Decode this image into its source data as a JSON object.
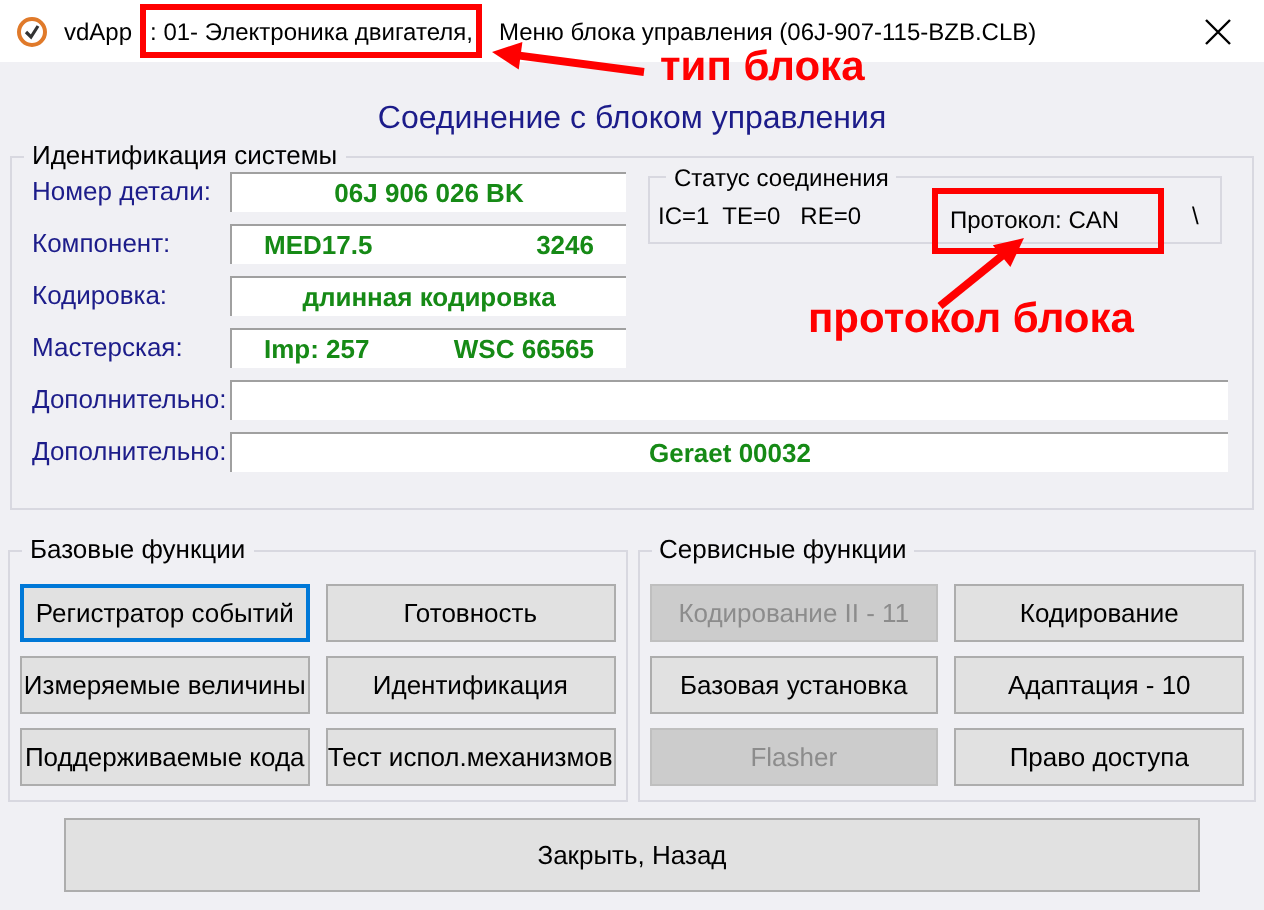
{
  "window": {
    "app_name": "vdApp",
    "module": ": 01- Электроника двигателя,",
    "title": "Меню блока управления (06J-907-115-BZB.CLB)"
  },
  "heading": "Соединение с блоком управления",
  "identification": {
    "title": "Идентификация системы",
    "rows": [
      {
        "label": "Номер детали:",
        "values": [
          "06J 906 026 BK"
        ],
        "wide": false
      },
      {
        "label": "Компонент:",
        "values": [
          "MED17.5",
          "3246"
        ],
        "wide": false
      },
      {
        "label": "Кодировка:",
        "values": [
          "длинная кодировка"
        ],
        "wide": false
      },
      {
        "label": "Мастерская:",
        "values": [
          "Imp: 257",
          "WSC 66565"
        ],
        "wide": false
      },
      {
        "label": "Дополнительно:",
        "values": [],
        "wide": true
      },
      {
        "label": "Дополнительно:",
        "values": [
          "Geraet 00032"
        ],
        "wide": true
      }
    ]
  },
  "connection_status": {
    "title": "Статус соединения",
    "counters": "IC=1  TE=0   RE=0",
    "protocol": "Протокол: CAN",
    "spinner": "\\"
  },
  "groups": [
    {
      "title": "Базовые функции",
      "buttons": [
        {
          "label": "Регистратор событий",
          "disabled": false,
          "focused": true
        },
        {
          "label": "Готовность",
          "disabled": false,
          "focused": false
        },
        {
          "label": "Измеряемые величины",
          "disabled": false,
          "focused": false
        },
        {
          "label": "Идентификация",
          "disabled": false,
          "focused": false
        },
        {
          "label": "Поддерживаемые кода",
          "disabled": false,
          "focused": false
        },
        {
          "label": "Тест испол.механизмов",
          "disabled": false,
          "focused": false
        }
      ]
    },
    {
      "title": "Сервисные функции",
      "buttons": [
        {
          "label": "Кодирование II - 11",
          "disabled": true,
          "focused": false
        },
        {
          "label": "Кодирование",
          "disabled": false,
          "focused": false
        },
        {
          "label": "Базовая установка",
          "disabled": false,
          "focused": false
        },
        {
          "label": "Адаптация - 10",
          "disabled": false,
          "focused": false
        },
        {
          "label": "Flasher",
          "disabled": true,
          "focused": false
        },
        {
          "label": "Право доступа",
          "disabled": false,
          "focused": false
        }
      ]
    }
  ],
  "close_button": "Закрыть, Назад",
  "annotations": [
    {
      "label": "тип блока"
    },
    {
      "label": "протокол блока"
    }
  ]
}
